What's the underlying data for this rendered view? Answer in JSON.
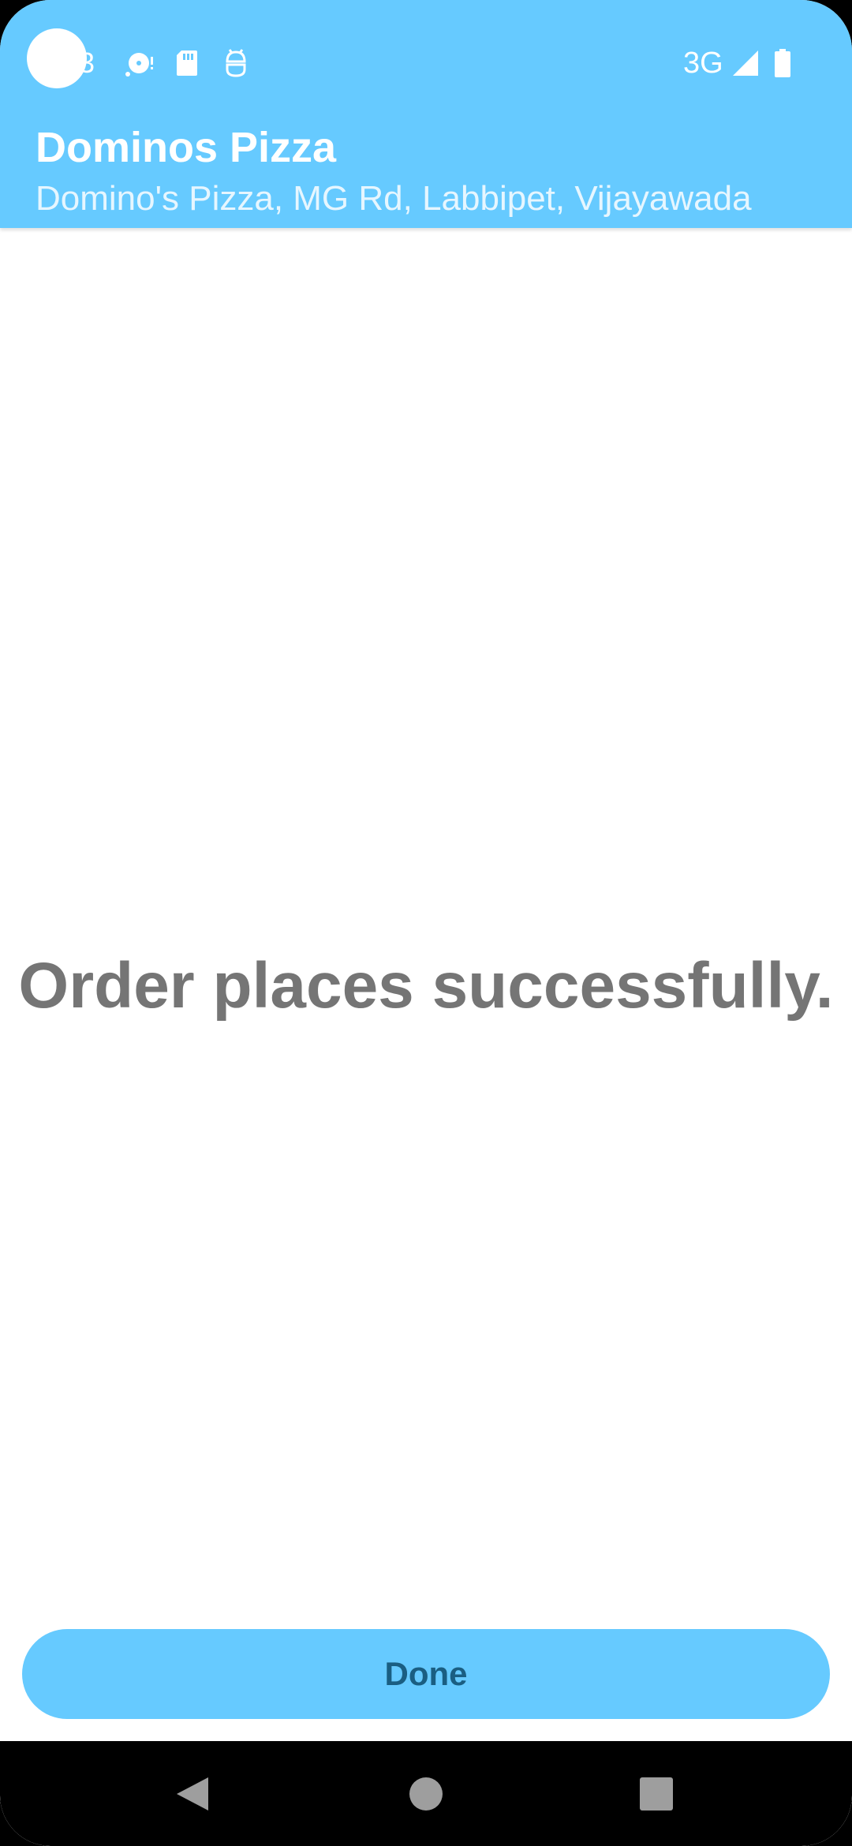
{
  "status_bar": {
    "time": "3",
    "network": "3G",
    "icons": [
      "camera-hole",
      "media-icon",
      "sd-card-icon",
      "android-icon",
      "signal-icon",
      "battery-icon"
    ]
  },
  "app_bar": {
    "title": "Dominos Pizza",
    "subtitle": "Domino's Pizza, MG Rd, Labbipet, Vijayawada"
  },
  "main": {
    "message": "Order places successfully."
  },
  "footer": {
    "done_label": "Done"
  },
  "nav_bar": {
    "icons": [
      "back-icon",
      "home-icon",
      "recents-icon"
    ]
  },
  "colors": {
    "accent": "#66CAFF",
    "button_text": "#1A5E82",
    "message_text": "#757575"
  }
}
